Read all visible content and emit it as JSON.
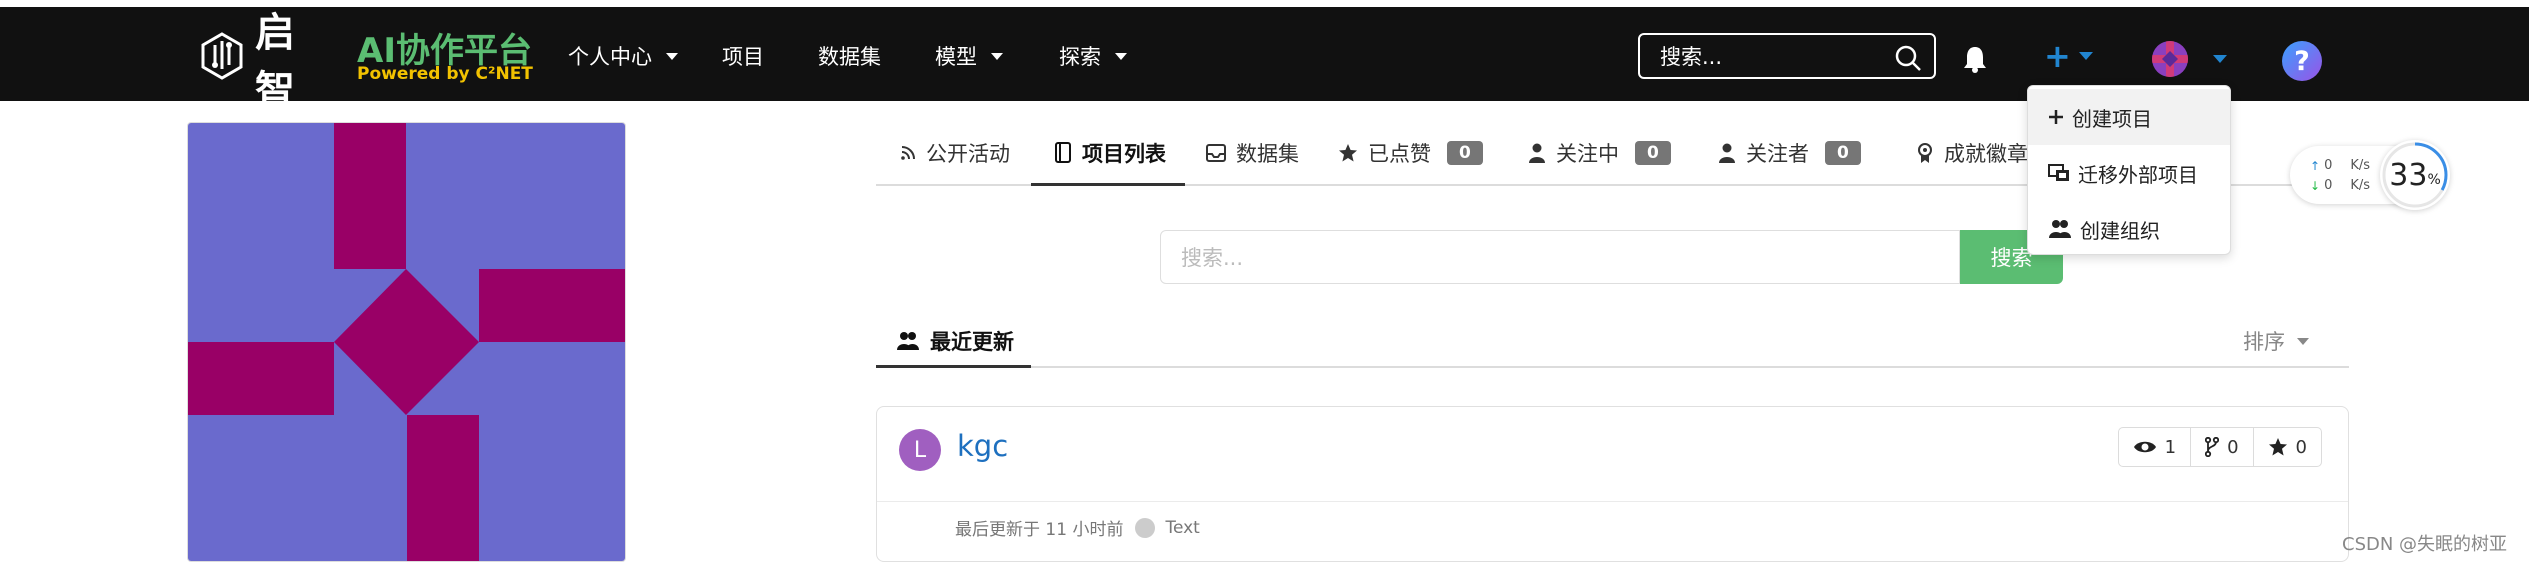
{
  "brand": {
    "logo_text": "启智",
    "title": "AI协作平台",
    "subtitle": "Powered by C²NET"
  },
  "nav": {
    "items": [
      {
        "label": "个人中心",
        "caret": true
      },
      {
        "label": "项目",
        "caret": false
      },
      {
        "label": "数据集",
        "caret": false
      },
      {
        "label": "模型",
        "caret": true
      },
      {
        "label": "探索",
        "caret": true
      }
    ],
    "search_placeholder": "搜索...",
    "plus_label": "+",
    "help_label": "?"
  },
  "dropdown": {
    "items": [
      {
        "label": "创建项目",
        "icon": "plus-icon"
      },
      {
        "label": "迁移外部项目",
        "icon": "migrate-icon"
      },
      {
        "label": "创建组织",
        "icon": "users-icon"
      }
    ]
  },
  "tabs": [
    {
      "label": "公开活动",
      "icon": "rss-icon",
      "count": null
    },
    {
      "label": "项目列表",
      "icon": "book-icon",
      "count": null,
      "active": true
    },
    {
      "label": "数据集",
      "icon": "inbox-icon",
      "count": null
    },
    {
      "label": "已点赞",
      "icon": "star-icon",
      "count": "0"
    },
    {
      "label": "关注中",
      "icon": "user-icon",
      "count": "0"
    },
    {
      "label": "关注者",
      "icon": "user-icon",
      "count": "0"
    },
    {
      "label": "成就徽章",
      "icon": "badge-icon",
      "count": null
    }
  ],
  "repo_search": {
    "placeholder": "搜索...",
    "button": "搜索"
  },
  "recent": {
    "label": "最近更新",
    "sort_label": "排序"
  },
  "repo": {
    "avatar_letter": "L",
    "name": "kgc",
    "watch_count": "1",
    "fork_count": "0",
    "star_count": "0",
    "updated_text": "最后更新于 11 小时前",
    "language": "Text"
  },
  "net_monitor": {
    "up": "0",
    "down": "0",
    "unit": "K/s",
    "percent": "33",
    "percent_sign": "%"
  },
  "watermark": "CSDN @失眠的树亚",
  "colors": {
    "navbar": "#111111",
    "brand_green": "#5bbd72",
    "brand_yellow": "#f2c200",
    "link_blue": "#1e70bf",
    "accent_blue": "#2185d0",
    "avatar_bg": "#6a6acd",
    "avatar_fg": "#990066"
  }
}
